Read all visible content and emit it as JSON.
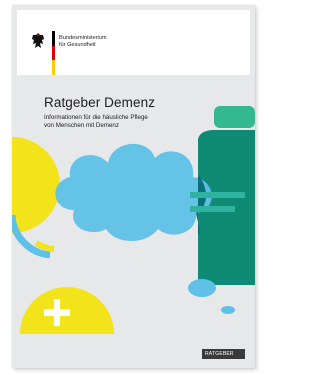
{
  "header": {
    "ministry_line1": "Bundesministerium",
    "ministry_line2": "für Gesundheit",
    "flag_colors": [
      "#000000",
      "#dd0000",
      "#ffce00"
    ]
  },
  "cover": {
    "title": "Ratgeber Demenz",
    "subtitle_line1": "Informationen für die häusliche Pflege",
    "subtitle_line2": "von Menschen mit Demenz",
    "series_label": "RATGEBER",
    "colors": {
      "background": "#e7e8ea",
      "yellow": "#f2e31a",
      "teal": "#0f8a74",
      "green": "#33b88f",
      "light_blue": "#5fc1e8"
    }
  }
}
